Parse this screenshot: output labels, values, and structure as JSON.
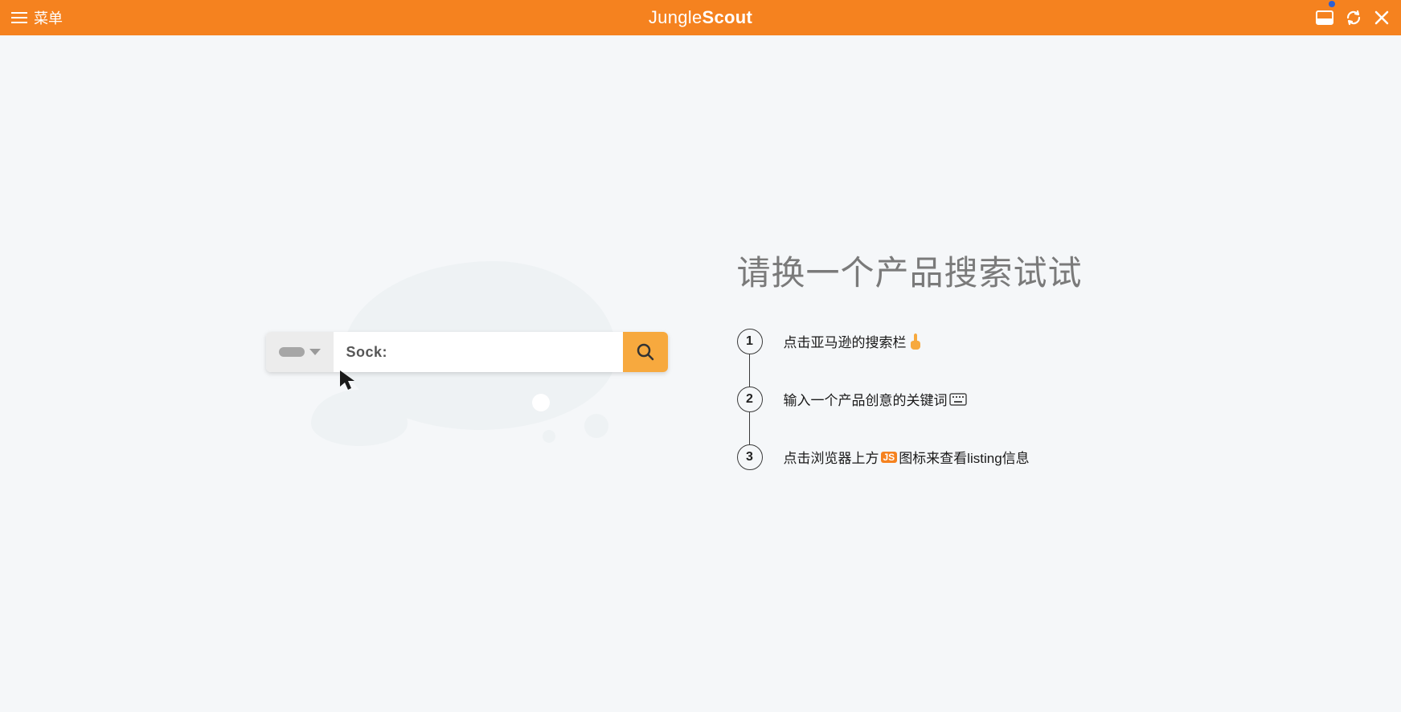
{
  "header": {
    "menu_label": "菜单",
    "brand_regular": "Jungle",
    "brand_bold": "Scout"
  },
  "illustration": {
    "search_text": "Sock:"
  },
  "right": {
    "title": "请换一个产品搜索试试",
    "steps": [
      {
        "num": "1",
        "text_before": "点击亚马逊的搜索栏",
        "icon": "point-up",
        "text_after": ""
      },
      {
        "num": "2",
        "text_before": "输入一个产品创意的关键词",
        "icon": "keyboard",
        "text_after": ""
      },
      {
        "num": "3",
        "text_before": "点击浏览器上方",
        "icon": "js-badge",
        "text_after": "图标来查看listing信息"
      }
    ],
    "js_badge_text": "JS"
  }
}
